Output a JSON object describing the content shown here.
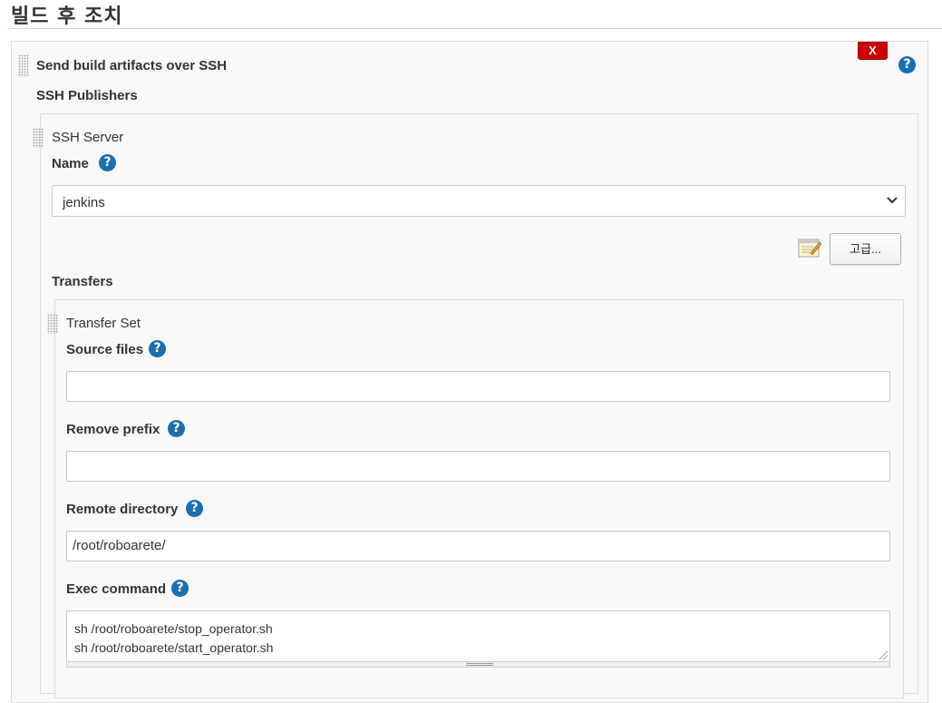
{
  "section": {
    "title": "빌드 후 조치"
  },
  "publisher": {
    "title": "Send build artifacts over SSH",
    "delete_label": "X",
    "ssh_publishers_label": "SSH Publishers",
    "server": {
      "title": "SSH Server",
      "name_label": "Name",
      "name_value": "jenkins",
      "advanced_label": "고급...",
      "transfers_label": "Transfers",
      "transfer_set": {
        "title": "Transfer Set",
        "source_files_label": "Source files",
        "source_files_value": "",
        "remove_prefix_label": "Remove prefix",
        "remove_prefix_value": "",
        "remote_directory_label": "Remote directory",
        "remote_directory_value": "/root/roboarete/",
        "exec_command_label": "Exec command",
        "exec_command_lines": [
          "sh /root/roboarete/stop_operator.sh",
          "sh /root/roboarete/start_operator.sh"
        ]
      }
    }
  },
  "help_glyph": "?",
  "colors": {
    "delete": "#cc0000",
    "help": "#1a6fb0"
  }
}
